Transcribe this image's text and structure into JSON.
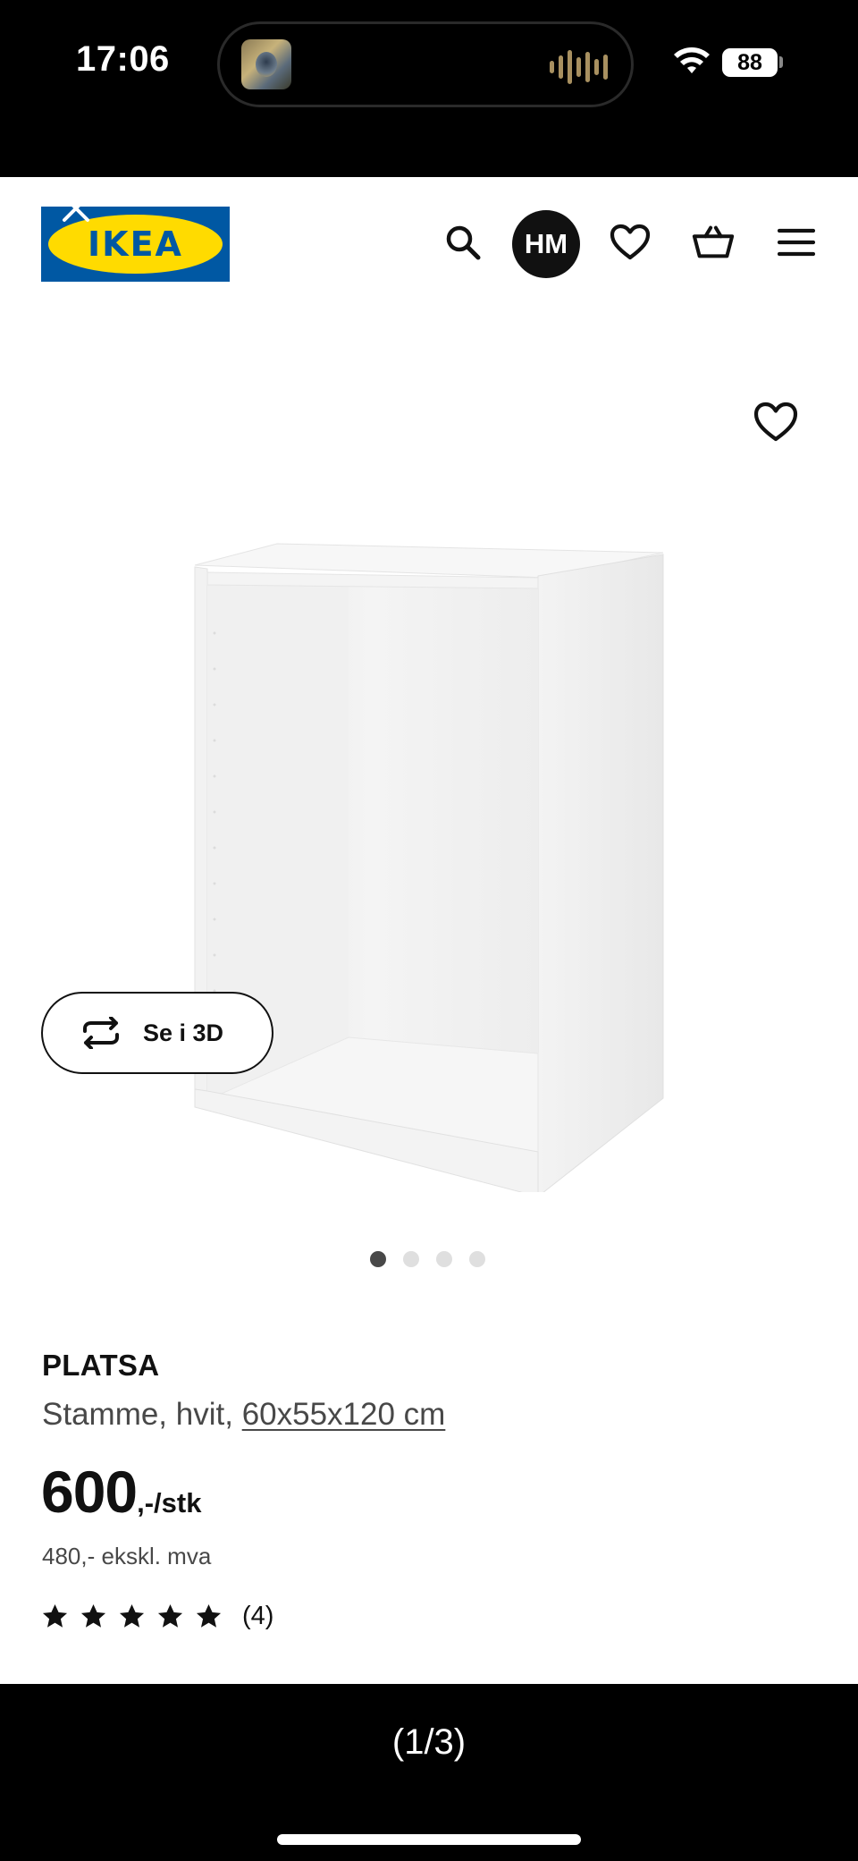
{
  "status_bar": {
    "time": "17:06",
    "battery": "88"
  },
  "header": {
    "logo_text": "IKEA",
    "avatar_initials": "HM"
  },
  "product": {
    "name": "PLATSA",
    "description": "Stamme, hvit,",
    "dimensions": "60x55x120 cm",
    "price_main": "600",
    "price_suffix": ",-/stk",
    "price_ex_vat": "480,- ekskl. mva",
    "rating": 5,
    "review_count": "(4)"
  },
  "view_3d_label": "Se i 3D",
  "carousel": {
    "total": 4,
    "active": 1
  },
  "pager": "(1/3)",
  "colors": {
    "ikea_blue": "#0058a3",
    "ikea_yellow": "#ffdb00",
    "text": "#111111",
    "muted": "#484848"
  },
  "icons": [
    "close-icon",
    "search-icon",
    "heart-icon",
    "basket-icon",
    "menu-icon",
    "rotate-3d-icon",
    "star-icon",
    "wifi-icon"
  ]
}
